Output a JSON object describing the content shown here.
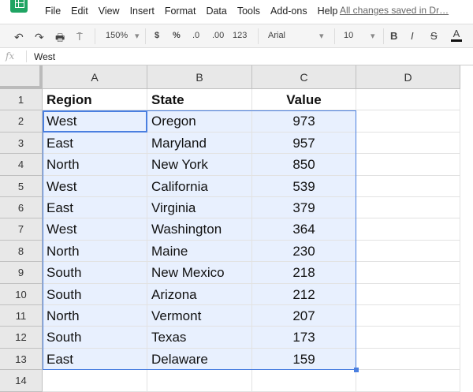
{
  "menu": [
    "File",
    "Edit",
    "View",
    "Insert",
    "Format",
    "Data",
    "Tools",
    "Add-ons",
    "Help"
  ],
  "save_status": "All changes saved in Dr…",
  "toolbar": {
    "zoom": "150%",
    "currency": "$",
    "percent": "%",
    "dec_less": ".0",
    "dec_more": ".00",
    "format": "123",
    "font": "Arial",
    "size": "10",
    "bold": "B",
    "italic": "I",
    "strike": "S",
    "text_color": "A"
  },
  "formula_bar": {
    "fx": "fx",
    "value": "West"
  },
  "columns": [
    "A",
    "B",
    "C",
    "D"
  ],
  "rows": [
    [
      "Region",
      "State",
      "Value"
    ],
    [
      "West",
      "Oregon",
      "973"
    ],
    [
      "East",
      "Maryland",
      "957"
    ],
    [
      "North",
      "New York",
      "850"
    ],
    [
      "West",
      "California",
      "539"
    ],
    [
      "East",
      "Virginia",
      "379"
    ],
    [
      "West",
      "Washington",
      "364"
    ],
    [
      "North",
      "Maine",
      "230"
    ],
    [
      "South",
      "New Mexico",
      "218"
    ],
    [
      "South",
      "Arizona",
      "212"
    ],
    [
      "North",
      "Vermont",
      "207"
    ],
    [
      "South",
      "Texas",
      "173"
    ],
    [
      "East",
      "Delaware",
      "159"
    ]
  ],
  "row_numbers": [
    "1",
    "2",
    "3",
    "4",
    "5",
    "6",
    "7",
    "8",
    "9",
    "10",
    "11",
    "12",
    "13",
    "14"
  ]
}
